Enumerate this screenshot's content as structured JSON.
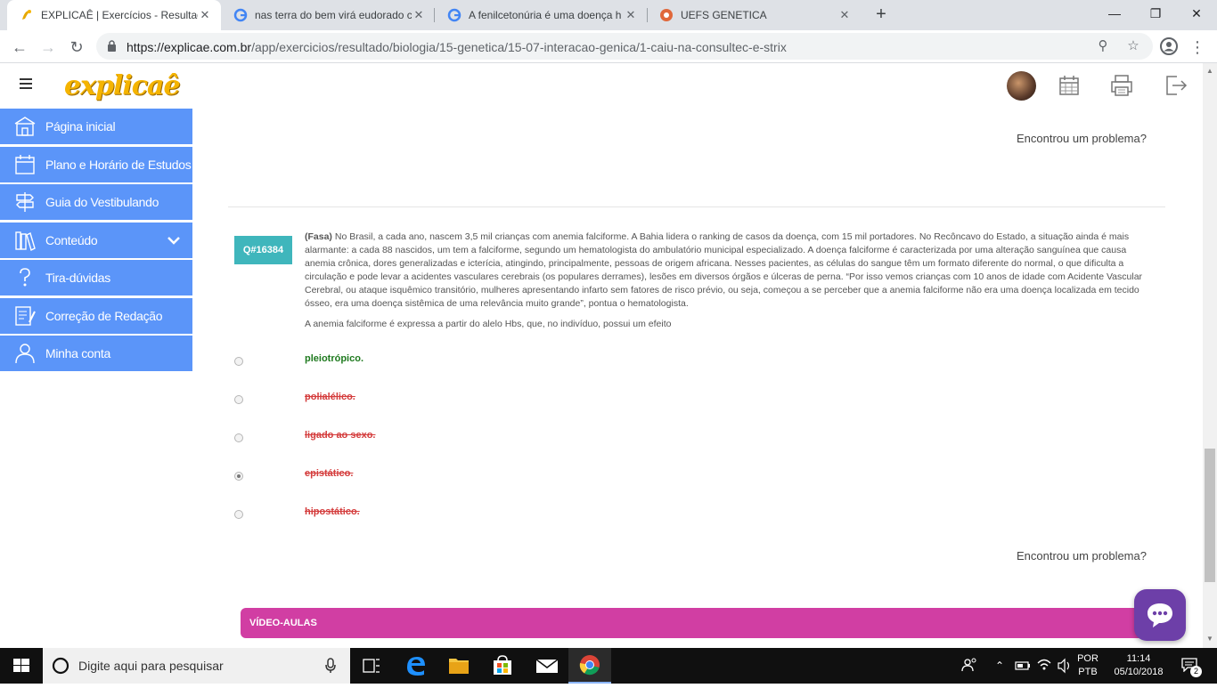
{
  "browser": {
    "tabs": [
      {
        "title": "EXPLICAÊ | Exercícios - Resultado",
        "active": true,
        "favicon": "explicae-logo-icon"
      },
      {
        "title": "nas terra do bem virá eudorado c",
        "active": false,
        "favicon": "google-icon"
      },
      {
        "title": "A fenilcetonúria é uma doença h",
        "active": false,
        "favicon": "google-icon"
      },
      {
        "title": "UEFS GENETICA",
        "active": false,
        "favicon": "uefs-icon"
      }
    ],
    "url_host": "https://explicae.com.br",
    "url_path": "/app/exercicios/resultado/biologia/15-genetica/15-07-interacao-genica/1-caiu-na-consultec-e-strix",
    "close_symbol": "✕",
    "new_tab_symbol": "+"
  },
  "app": {
    "logo_text": "explicaê",
    "sidebar": [
      {
        "label": "Página inicial",
        "icon": "home-icon"
      },
      {
        "label": "Plano e Horário de Estudos",
        "icon": "calendar-icon"
      },
      {
        "label": "Guia do Vestibulando",
        "icon": "signpost-icon"
      },
      {
        "label": "Conteúdo",
        "icon": "books-icon",
        "has_chevron": true
      },
      {
        "label": "Tira-dúvidas",
        "icon": "question-icon"
      },
      {
        "label": "Correção de Redação",
        "icon": "essay-icon"
      },
      {
        "label": "Minha conta",
        "icon": "user-icon"
      }
    ],
    "header_icons": [
      "avatar",
      "calendar-icon",
      "printer-icon",
      "logout-icon"
    ]
  },
  "content": {
    "problem_link_top": "Encontrou um problema?",
    "problem_link_bottom": "Encontrou um problema?",
    "question": {
      "id": "Q#16384",
      "source": "(Fasa)",
      "text": " No Brasil, a cada ano, nascem 3,5 mil crianças com anemia falciforme. A Bahia lidera o ranking de casos da doença, com 15 mil portadores. No Recôncavo do Estado, a situação ainda é mais alarmante: a cada 88 nascidos, um tem a falciforme, segundo um hematologista do ambulatório municipal especializado. A doença falciforme é caracterizada por uma alteração sanguínea que causa anemia crônica, dores generalizadas e icterícia, atingindo, principalmente, pessoas de origem africana. Nesses pacientes, as células do sangue têm um formato diferente do normal, o que dificulta a circulação e pode levar a acidentes vasculares cerebrais (os populares derrames), lesões em diversos órgãos e úlceras de perna. “Por isso vemos crianças com 10 anos de idade com Acidente Vascular Cerebral, ou ataque isquêmico transitório, mulheres apresentando infarto sem fatores de risco prévio, ou seja, começou a se perceber que a anemia falciforme não era uma doença localizada em tecido ósseo, era uma doença sistêmica de uma relevância muito grande”, pontua o hematologista.",
      "prompt": "A anemia falciforme é expressa a partir do alelo Hbs, que, no indivíduo, possui um efeito",
      "options": [
        {
          "label": "pleiotrópico.",
          "status": "correct",
          "selected": false
        },
        {
          "label": "polialélico.",
          "status": "wrong",
          "selected": false
        },
        {
          "label": "ligado ao sexo.",
          "status": "wrong",
          "selected": false
        },
        {
          "label": "epistático.",
          "status": "wrong",
          "selected": true
        },
        {
          "label": "hipostático.",
          "status": "wrong",
          "selected": false
        }
      ]
    },
    "video_section_label": "VÍDEO-AULAS"
  },
  "taskbar": {
    "search_placeholder": "Digite aqui para pesquisar",
    "lang_top": "POR",
    "lang_bottom": "PTB",
    "time": "11:14",
    "date": "05/10/2018",
    "notification_count": "2"
  },
  "colors": {
    "sidebar_blue": "#5b95f9",
    "badge_teal": "#3fb6bc",
    "correct_green": "#1f7a1f",
    "wrong_red": "#d43c3c",
    "video_pink": "#d13ea3",
    "chat_purple": "#6d3fa8",
    "logo_yellow": "#f5b400"
  }
}
